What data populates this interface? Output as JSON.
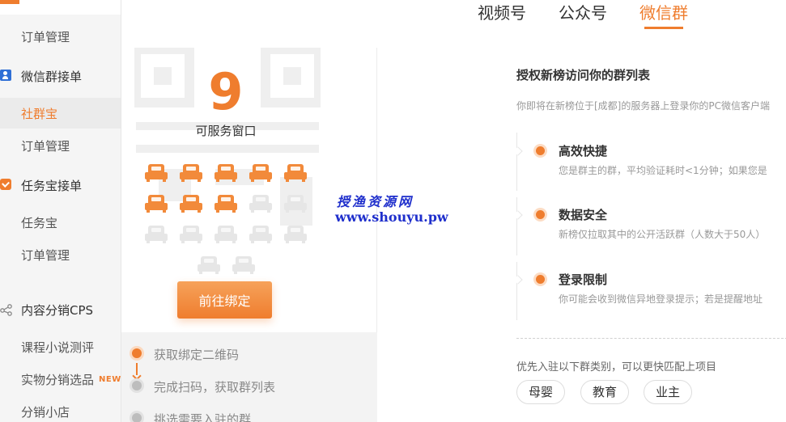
{
  "tabs": [
    {
      "label": "视频号",
      "active": false
    },
    {
      "label": "公众号",
      "active": false
    },
    {
      "label": "微信群",
      "active": true
    }
  ],
  "sidebar": {
    "items": [
      {
        "label": "订单管理",
        "kind": "child",
        "active": false
      },
      {
        "label": "微信群接单",
        "kind": "group",
        "icon": "user-badge-icon"
      },
      {
        "label": "社群宝",
        "kind": "child",
        "active": true
      },
      {
        "label": "订单管理",
        "kind": "child",
        "active": false
      },
      {
        "label": "任务宝接单",
        "kind": "group",
        "icon": "task-check-icon"
      },
      {
        "label": "任务宝",
        "kind": "child",
        "active": false
      },
      {
        "label": "订单管理",
        "kind": "child",
        "active": false
      },
      {
        "label": "内容分销CPS",
        "kind": "group",
        "icon": "share-nodes-icon"
      },
      {
        "label": "课程小说测评",
        "kind": "child",
        "active": false
      },
      {
        "label": "实物分销选品",
        "kind": "child",
        "active": false,
        "badge": "NEW"
      },
      {
        "label": "分销小店",
        "kind": "child",
        "active": false
      }
    ]
  },
  "service": {
    "available_count": "9",
    "available_label": "可服务窗口",
    "seats_total": 17,
    "seats_filled": 8,
    "bind_button": "前往绑定"
  },
  "steps": [
    {
      "label": "获取绑定二维码",
      "status": "active"
    },
    {
      "label": "完成扫码，获取群列表",
      "status": "pending"
    },
    {
      "label": "挑选需要入驻的群",
      "status": "pending"
    }
  ],
  "watermark": {
    "name": "授渔资源网",
    "url": "www.shouyu.pw"
  },
  "auth": {
    "title": "授权新榜访问你的群列表",
    "desc": "你即将在新榜位于[成都]的服务器上登录你的PC微信客户端",
    "features": [
      {
        "title": "高效快捷",
        "desc": "您是群主的群，平均验证耗时<1分钟；如果您是"
      },
      {
        "title": "数据安全",
        "desc": "新榜仅拉取其中的公开活跃群（人数大于50人）"
      },
      {
        "title": "登录限制",
        "desc": "你可能会收到微信异地登录提示；若是提醒地址"
      }
    ],
    "preference_text": "优先入驻以下群类别，可以更快匹配上项目",
    "categories": [
      "母婴",
      "教育",
      "业主"
    ]
  },
  "colors": {
    "accent": "#ef7d2e",
    "watermark": "#1f2fcc",
    "seat_empty": "#e6e6e6"
  }
}
